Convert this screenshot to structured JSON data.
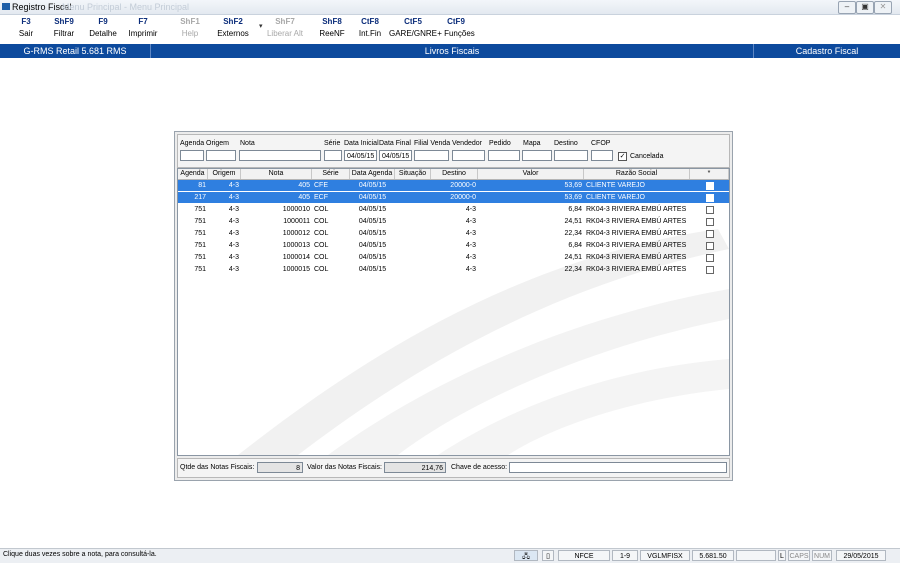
{
  "window": {
    "title": "Registro Fiscal",
    "ghost_title": "Menu Principal - Menu Principal"
  },
  "toolbar": [
    {
      "key": "F3",
      "label": "Sair",
      "disabled": false
    },
    {
      "key": "ShF9",
      "label": "Filtrar",
      "disabled": false
    },
    {
      "key": "F9",
      "label": "Detalhe",
      "disabled": false
    },
    {
      "key": "F7",
      "label": "Imprimir",
      "disabled": false
    },
    {
      "key": "ShF1",
      "label": "Help",
      "disabled": true
    },
    {
      "key": "ShF2",
      "label": "Externos",
      "disabled": false
    },
    {
      "key": "ShF7",
      "label": "Liberar Alt",
      "disabled": true
    },
    {
      "key": "ShF8",
      "label": "ReeNF",
      "disabled": false
    },
    {
      "key": "CtF8",
      "label": "Int.Fin",
      "disabled": false
    },
    {
      "key": "CtF5",
      "label": "GARE/GNRE",
      "disabled": false
    },
    {
      "key": "CtF9",
      "label": "+ Funções",
      "disabled": false
    }
  ],
  "header": {
    "left": "G-RMS Retail 5.681 RMS",
    "center": "Livros Fiscais",
    "right": "Cadastro Fiscal"
  },
  "filters": {
    "agenda": "Agenda",
    "origem": "Origem",
    "nota": "Nota",
    "serie": "Série",
    "data_inicial": "Data Inicial",
    "data_final": "Data Final",
    "filial_venda": "Filial Venda",
    "vendedor": "Vendedor",
    "pedido": "Pedido",
    "mapa": "Mapa",
    "destino": "Destino",
    "cfop": "CFOP",
    "data_inicial_value": "04/05/15",
    "data_final_value": "04/05/15",
    "cancelada_label": "Cancelada",
    "cancelada_checked": "✓"
  },
  "columns": [
    "Agenda",
    "Origem",
    "Nota",
    "Série",
    "Data Agenda",
    "Situação",
    "Destino",
    "Valor",
    "Razão Social",
    "*"
  ],
  "rows": [
    {
      "agenda": "81",
      "origem": "4-3",
      "nota": "405",
      "serie": "CFE",
      "data": "04/05/15",
      "situacao": "",
      "destino": "20000-0",
      "valor": "53,69",
      "razao": "CLIENTE VAREJO",
      "selected": true
    },
    {
      "agenda": "217",
      "origem": "4-3",
      "nota": "405",
      "serie": "ECF",
      "data": "04/05/15",
      "situacao": "",
      "destino": "20000-0",
      "valor": "53,69",
      "razao": "CLIENTE VAREJO",
      "selected": true
    },
    {
      "agenda": "751",
      "origem": "4-3",
      "nota": "1000010",
      "serie": "COL",
      "data": "04/05/15",
      "situacao": "",
      "destino": "4-3",
      "valor": "6,84",
      "razao": "RK04-3 RIVIERA EMBÚ ARTES",
      "selected": false
    },
    {
      "agenda": "751",
      "origem": "4-3",
      "nota": "1000011",
      "serie": "COL",
      "data": "04/05/15",
      "situacao": "",
      "destino": "4-3",
      "valor": "24,51",
      "razao": "RK04-3 RIVIERA EMBÚ ARTES",
      "selected": false
    },
    {
      "agenda": "751",
      "origem": "4-3",
      "nota": "1000012",
      "serie": "COL",
      "data": "04/05/15",
      "situacao": "",
      "destino": "4-3",
      "valor": "22,34",
      "razao": "RK04-3 RIVIERA EMBÚ ARTES",
      "selected": false
    },
    {
      "agenda": "751",
      "origem": "4-3",
      "nota": "1000013",
      "serie": "COL",
      "data": "04/05/15",
      "situacao": "",
      "destino": "4-3",
      "valor": "6,84",
      "razao": "RK04-3 RIVIERA EMBÚ ARTES",
      "selected": false
    },
    {
      "agenda": "751",
      "origem": "4-3",
      "nota": "1000014",
      "serie": "COL",
      "data": "04/05/15",
      "situacao": "",
      "destino": "4-3",
      "valor": "24,51",
      "razao": "RK04-3 RIVIERA EMBÚ ARTES",
      "selected": false
    },
    {
      "agenda": "751",
      "origem": "4-3",
      "nota": "1000015",
      "serie": "COL",
      "data": "04/05/15",
      "situacao": "",
      "destino": "4-3",
      "valor": "22,34",
      "razao": "RK04-3 RIVIERA EMBÚ ARTES",
      "selected": false
    }
  ],
  "footer": {
    "qtde_label": "Qtde das Notas Fiscais:",
    "qtde_value": "8",
    "valor_label": "Valor das Notas Fiscais:",
    "valor_value": "214,76",
    "chave_label": "Chave de acesso:",
    "chave_value": ""
  },
  "status": {
    "message": "Clique duas vezes sobre a nota, para consultá-la.",
    "doc_type": "NFCE",
    "filial": "1-9",
    "program": "VGLMFISX",
    "version": "5.681.50",
    "l": "L",
    "caps": "CAPS",
    "num": "NUM",
    "date": "29/05/2015"
  },
  "colors": {
    "header_band": "#0d4a9d",
    "selection": "#2f7fe0",
    "key_text": "#0a2c7a"
  }
}
